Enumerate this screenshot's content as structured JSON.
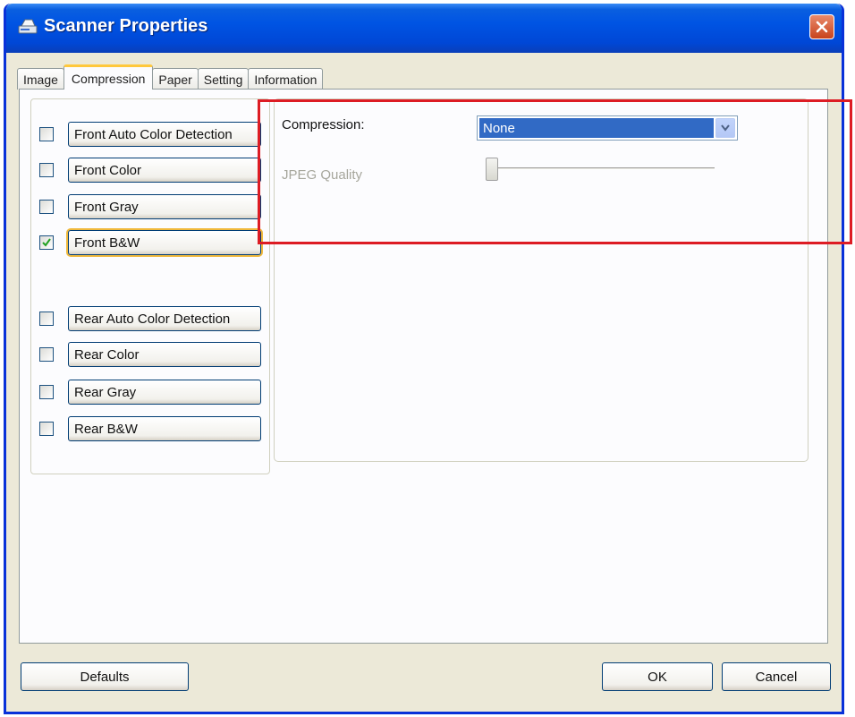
{
  "window": {
    "title": "Scanner Properties"
  },
  "tabs": [
    {
      "label": "Image"
    },
    {
      "label": "Compression"
    },
    {
      "label": "Paper"
    },
    {
      "label": "Setting"
    },
    {
      "label": "Information"
    }
  ],
  "active_tab": "Compression",
  "image_types": [
    {
      "label": "Front Auto Color Detection",
      "checked": false
    },
    {
      "label": "Front Color",
      "checked": false
    },
    {
      "label": "Front Gray",
      "checked": false
    },
    {
      "label": "Front B&W",
      "checked": true
    },
    {
      "label": "Rear Auto Color Detection",
      "checked": false
    },
    {
      "label": "Rear Color",
      "checked": false
    },
    {
      "label": "Rear Gray",
      "checked": false
    },
    {
      "label": "Rear B&W",
      "checked": false
    }
  ],
  "compression": {
    "label": "Compression:",
    "value": "None",
    "jpeg_quality_label": "JPEG Quality",
    "jpeg_quality_enabled": false
  },
  "buttons": {
    "defaults": "Defaults",
    "ok": "OK",
    "cancel": "Cancel"
  },
  "colors": {
    "titlebar": "#0054e3",
    "selection": "#316ac5",
    "highlight_box": "#dd1c24"
  }
}
